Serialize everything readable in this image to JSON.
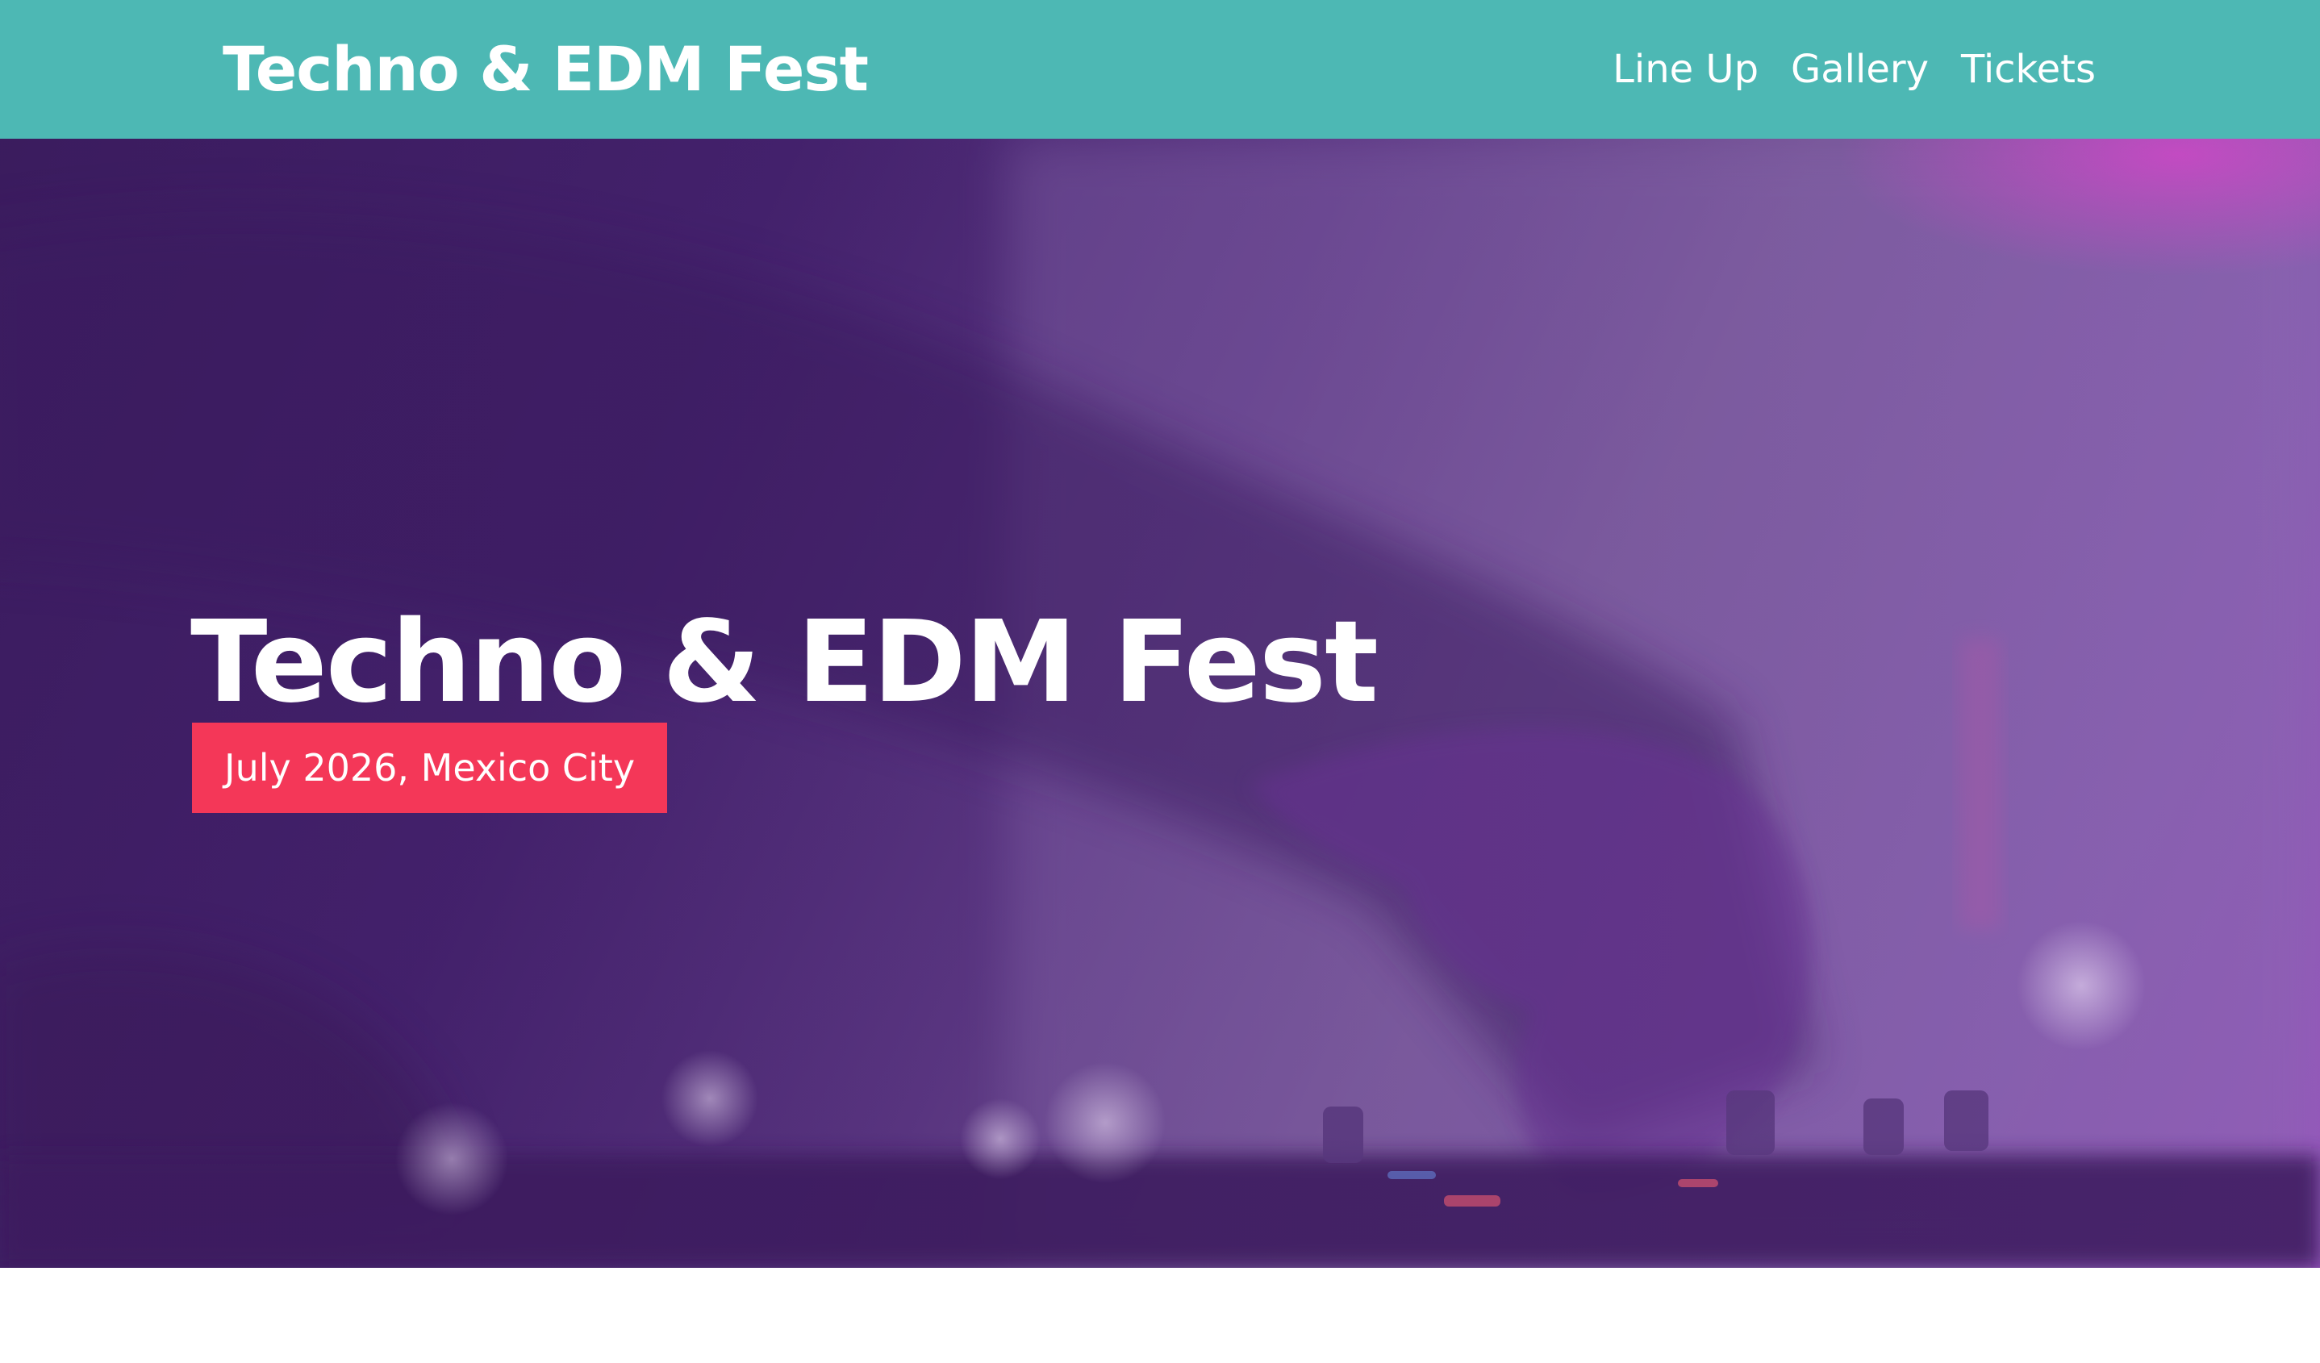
{
  "header": {
    "brand": "Techno & EDM Fest",
    "nav": [
      {
        "label": "Line Up"
      },
      {
        "label": "Gallery"
      },
      {
        "label": "Tickets"
      }
    ]
  },
  "hero": {
    "title": "Techno & EDM Fest",
    "badge": "July 2026, Mexico City"
  },
  "colors": {
    "navbar": "#4db8b4",
    "badge": "#f43758",
    "hero_tint": "#45236f"
  }
}
